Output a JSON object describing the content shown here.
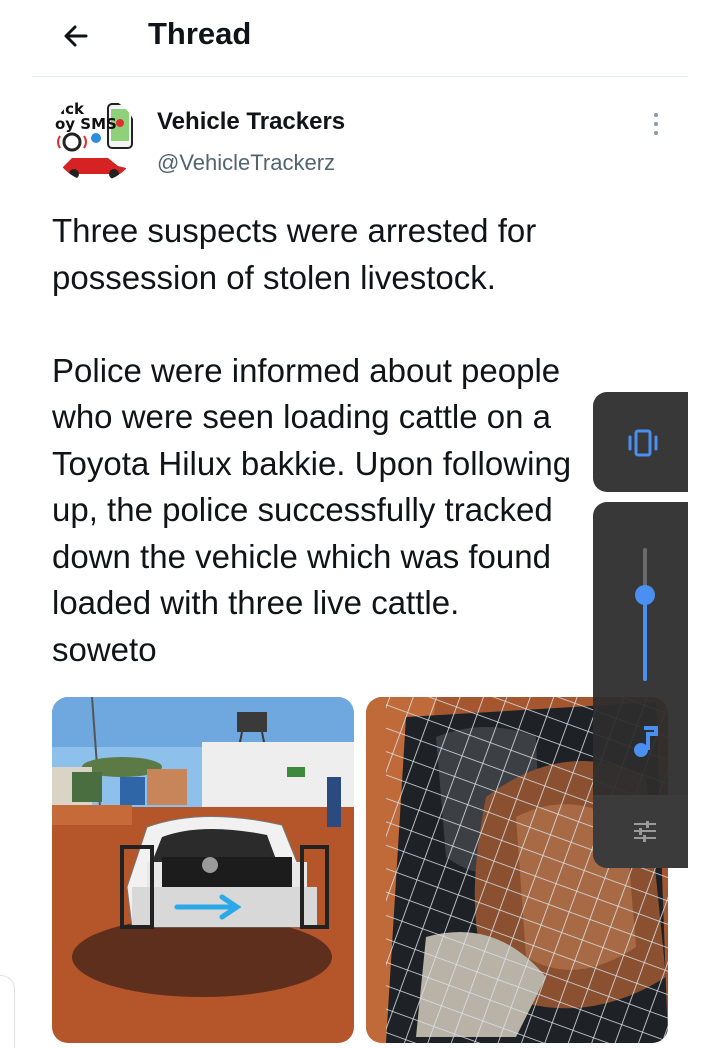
{
  "header": {
    "title": "Thread"
  },
  "author": {
    "name": "Vehicle Trackers",
    "handle": "@VehicleTrackerz",
    "avatar_text_top": "ack",
    "avatar_text_bottom": "oy SMS"
  },
  "tweet": {
    "lines": [
      "Three suspects were arrested for",
      "possession of stolen livestock.",
      "",
      "Police were informed about people",
      "who were seen loading cattle on a",
      "Toyota Hilux bakkie. Upon following",
      "up, the police successfully tracked",
      "down the vehicle which was found",
      "loaded with three live cattle.",
      "soweto"
    ]
  },
  "media": [
    {
      "label": "white-pickup-truck-photo"
    },
    {
      "label": "cattle-in-truck-bed-photo"
    }
  ],
  "volume_panel": {
    "level": 0.65,
    "accent": "#4a8ff2"
  },
  "icons": {
    "back": "arrow-left-icon",
    "more": "more-vertical-icon",
    "vibrate": "vibrate-icon",
    "music": "music-note-icon",
    "equalizer": "equalizer-icon"
  }
}
